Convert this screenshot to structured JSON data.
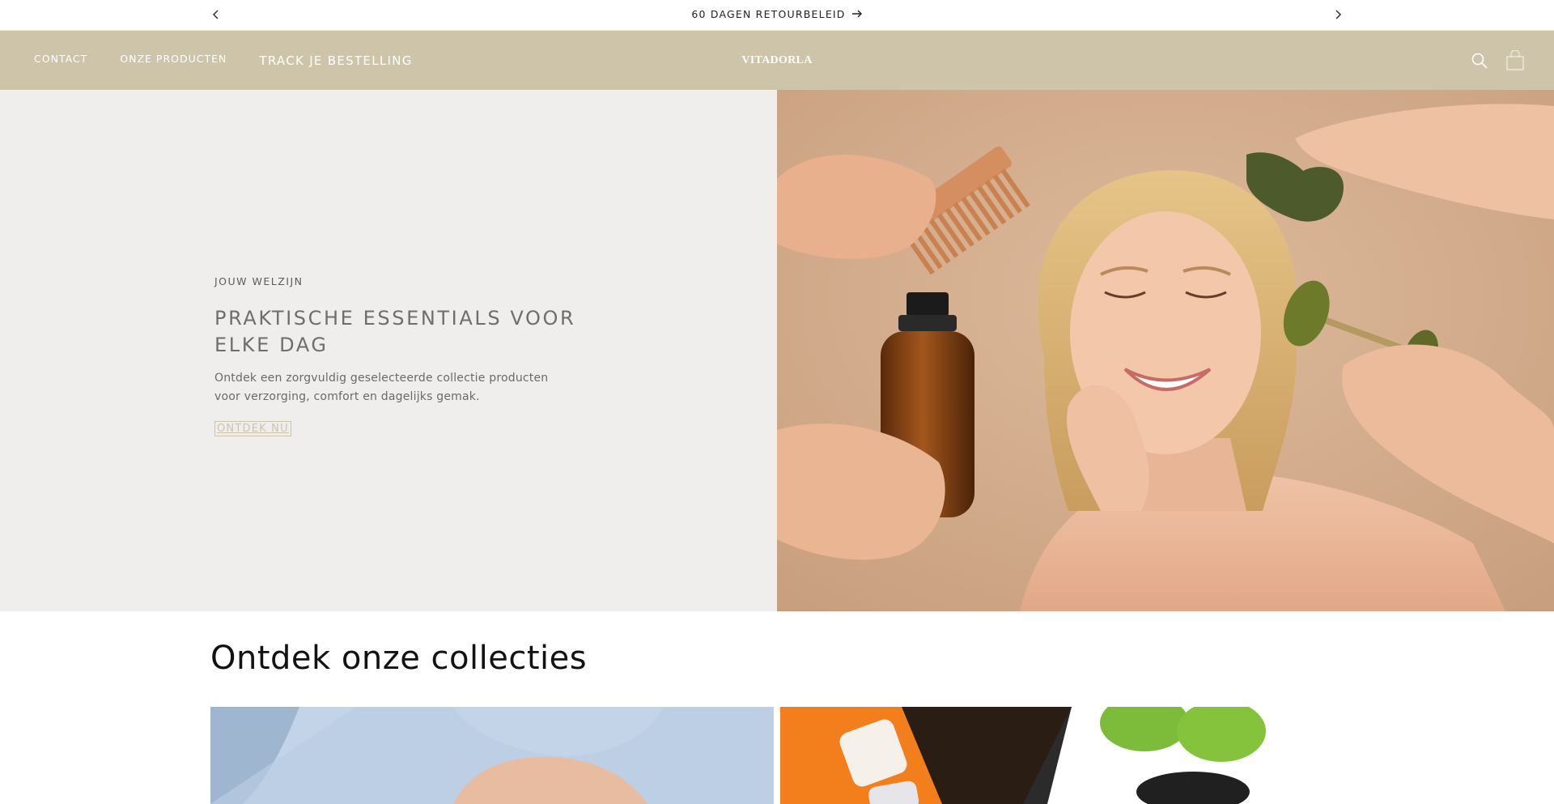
{
  "announcement": {
    "message": "60 DAGEN RETOURBELEID",
    "prev_icon": "chevron-left-icon",
    "next_icon": "chevron-right-icon",
    "arrow_icon": "arrow-right-icon"
  },
  "header": {
    "bg_color": "#cdc4a9",
    "nav": [
      {
        "label": "CONTACT"
      },
      {
        "label": "ONZE PRODUCTEN"
      },
      {
        "label": "TRACK JE BESTELLING"
      }
    ],
    "logo": "VITADORLA",
    "icons": [
      "search-icon",
      "cart-icon"
    ]
  },
  "hero": {
    "eyebrow": "JOUW WELZIJN",
    "title": "PRAKTISCHE ESSENTIALS VOOR ELKE DAG",
    "description": "Ontdek een zorgvuldig geselecteerde collectie producten voor verzorging, comfort en dagelijks gemak.",
    "button_label": "ONTDEK NU"
  },
  "collections": {
    "title": "Ontdek onze collecties"
  }
}
